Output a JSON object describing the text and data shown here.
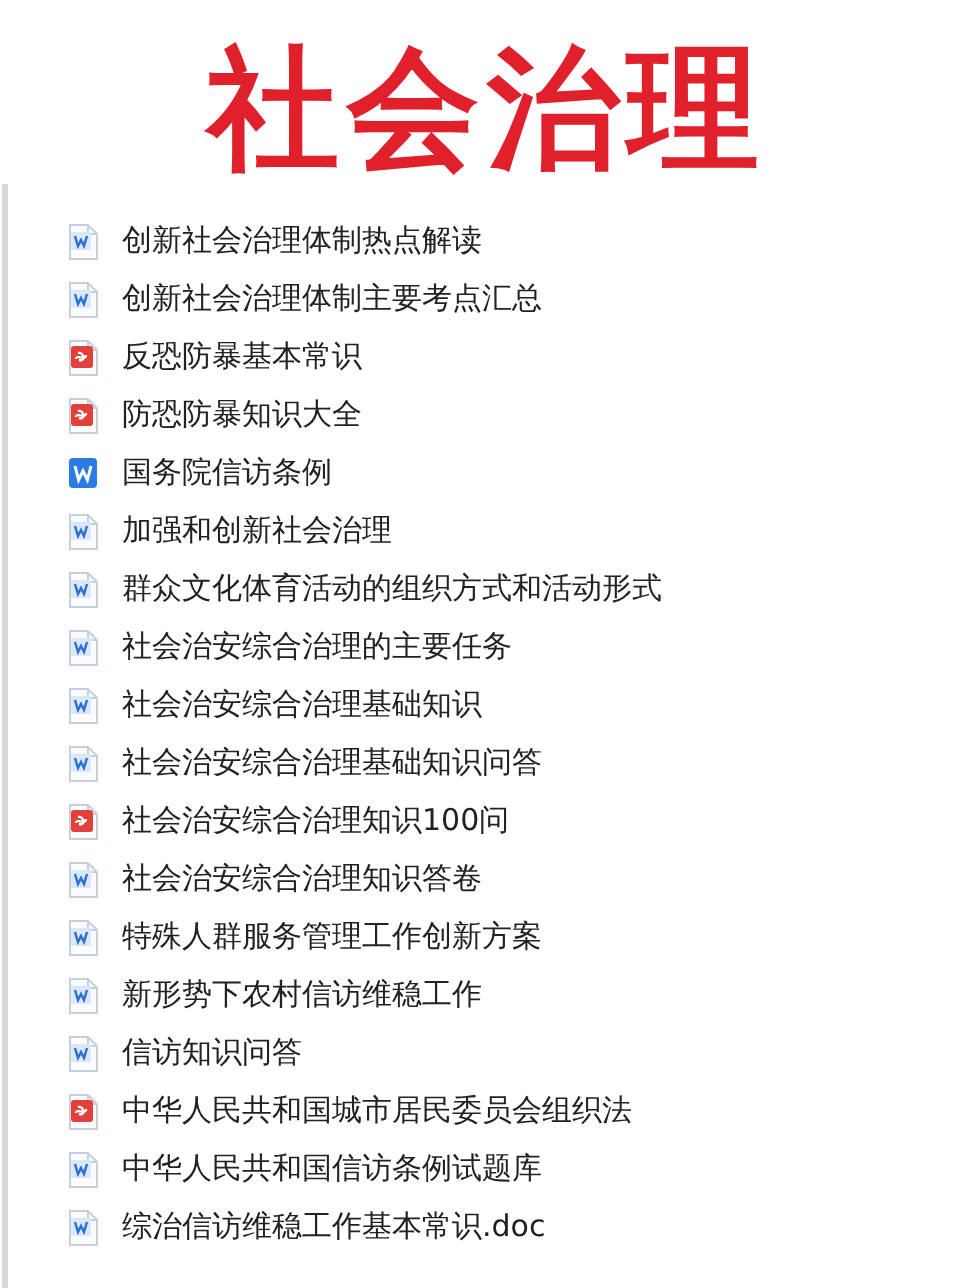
{
  "title": "社会治理",
  "files": [
    {
      "kind": "doc",
      "name": "创新社会治理体制热点解读"
    },
    {
      "kind": "doc",
      "name": "创新社会治理体制主要考点汇总"
    },
    {
      "kind": "pdf",
      "name": "反恐防暴基本常识"
    },
    {
      "kind": "pdf",
      "name": "防恐防暴知识大全"
    },
    {
      "kind": "wps",
      "name": "国务院信访条例"
    },
    {
      "kind": "doc",
      "name": "加强和创新社会治理"
    },
    {
      "kind": "doc",
      "name": "群众文化体育活动的组织方式和活动形式"
    },
    {
      "kind": "doc",
      "name": "社会治安综合治理的主要任务"
    },
    {
      "kind": "doc",
      "name": "社会治安综合治理基础知识"
    },
    {
      "kind": "doc",
      "name": "社会治安综合治理基础知识问答"
    },
    {
      "kind": "pdf",
      "name": "社会治安综合治理知识100问"
    },
    {
      "kind": "doc",
      "name": "社会治安综合治理知识答卷"
    },
    {
      "kind": "doc",
      "name": "特殊人群服务管理工作创新方案"
    },
    {
      "kind": "doc",
      "name": "新形势下农村信访维稳工作"
    },
    {
      "kind": "doc",
      "name": "信访知识问答"
    },
    {
      "kind": "pdf",
      "name": "中华人民共和国城市居民委员会组织法"
    },
    {
      "kind": "doc",
      "name": "中华人民共和国信访条例试题库"
    },
    {
      "kind": "doc",
      "name": "综治信访维稳工作基本常识.doc"
    }
  ]
}
